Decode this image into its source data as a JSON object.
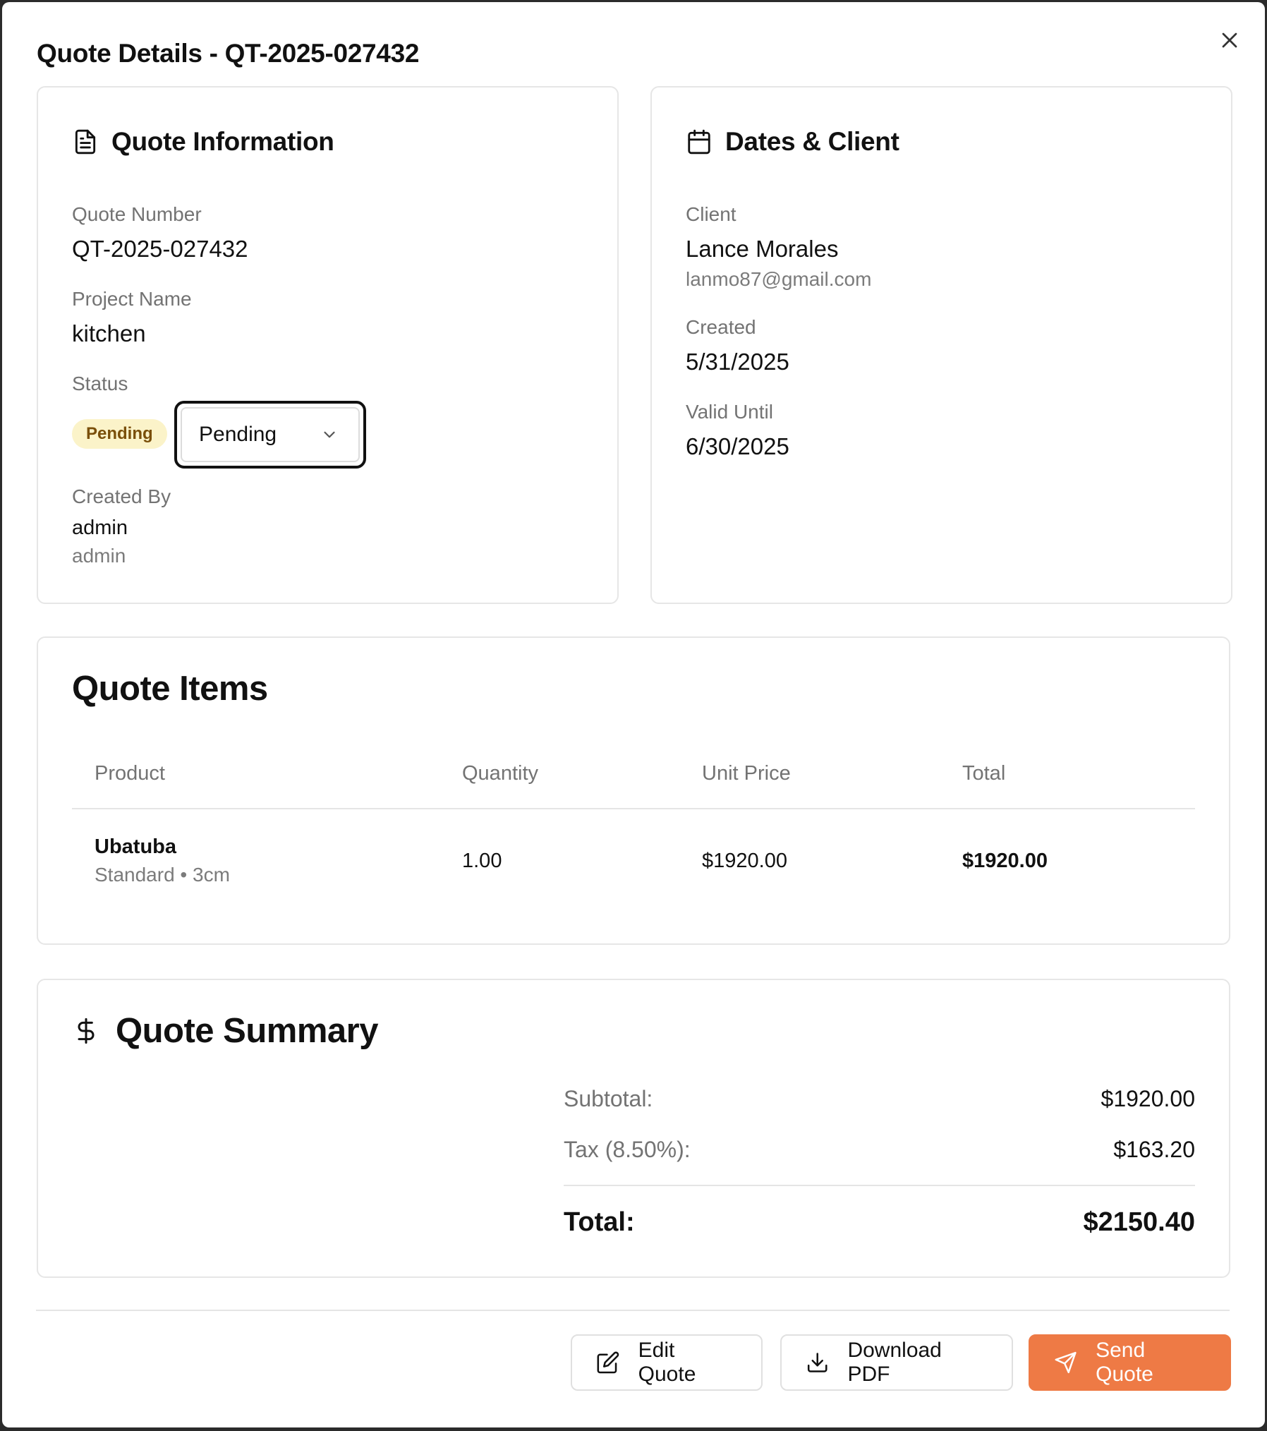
{
  "modal": {
    "title": "Quote Details - QT-2025-027432"
  },
  "quote_info": {
    "heading": "Quote Information",
    "quote_number_label": "Quote Number",
    "quote_number": "QT-2025-027432",
    "project_name_label": "Project Name",
    "project_name": "kitchen",
    "status_label": "Status",
    "status_badge": "Pending",
    "status_select_value": "Pending",
    "created_by_label": "Created By",
    "created_by_name": "admin",
    "created_by_role": "admin"
  },
  "dates_client": {
    "heading": "Dates & Client",
    "client_label": "Client",
    "client_name": "Lance Morales",
    "client_email": "lanmo87@gmail.com",
    "created_label": "Created",
    "created_date": "5/31/2025",
    "valid_until_label": "Valid Until",
    "valid_until_date": "6/30/2025"
  },
  "quote_items": {
    "heading": "Quote Items",
    "columns": [
      "Product",
      "Quantity",
      "Unit Price",
      "Total"
    ],
    "rows": [
      {
        "product": "Ubatuba",
        "details": "Standard • 3cm",
        "quantity": "1.00",
        "unit_price": "$1920.00",
        "total": "$1920.00"
      }
    ]
  },
  "summary": {
    "heading": "Quote Summary",
    "subtotal_label": "Subtotal:",
    "subtotal": "$1920.00",
    "tax_label": "Tax (8.50%):",
    "tax": "$163.20",
    "total_label": "Total:",
    "total": "$2150.40"
  },
  "actions": {
    "edit_label": "Edit Quote",
    "download_label": "Download PDF",
    "send_label": "Send Quote"
  },
  "colors": {
    "accent": "#ee7a45",
    "badge_bg": "#fbf3c9",
    "badge_text": "#7a4f0a"
  },
  "icons": {
    "close": "close-icon",
    "quote_info": "file-text-icon",
    "dates_client": "calendar-icon",
    "summary": "dollar-sign-icon",
    "select": "chevron-down-icon",
    "edit": "edit-icon",
    "download": "download-icon",
    "send": "send-icon"
  }
}
